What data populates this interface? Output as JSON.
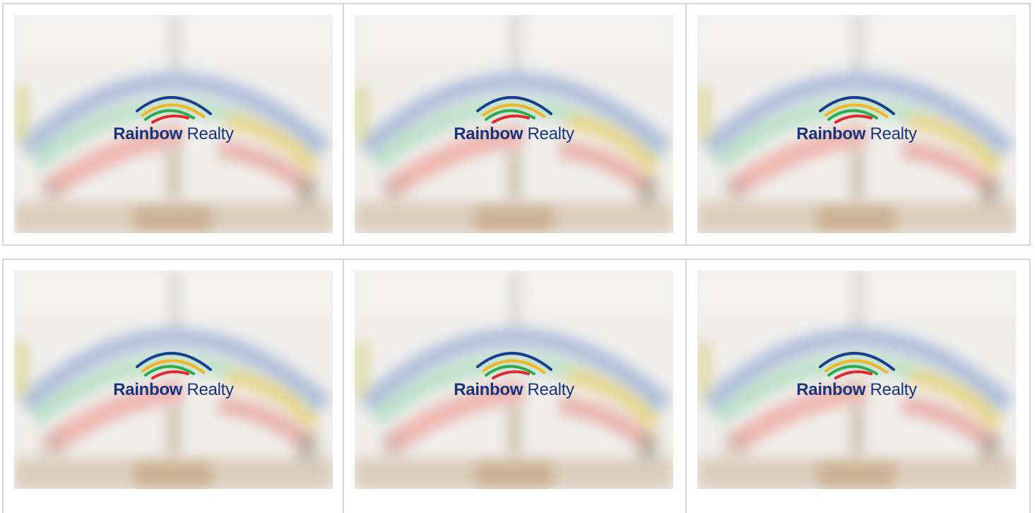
{
  "cards": [
    {
      "brand_bold": "Rainbow",
      "brand_light": "Realty"
    },
    {
      "brand_bold": "Rainbow",
      "brand_light": "Realty"
    },
    {
      "brand_bold": "Rainbow",
      "brand_light": "Realty"
    },
    {
      "brand_bold": "Rainbow",
      "brand_light": "Realty"
    },
    {
      "brand_bold": "Rainbow",
      "brand_light": "Realty"
    },
    {
      "brand_bold": "Rainbow",
      "brand_light": "Realty"
    }
  ],
  "colors": {
    "brand_navy": "#16357d",
    "arc_blue": "#1b3f8f",
    "arc_yellow": "#f5b321",
    "arc_green": "#2fa84f",
    "arc_red": "#e3262f",
    "divider": "#d6d6d6"
  }
}
